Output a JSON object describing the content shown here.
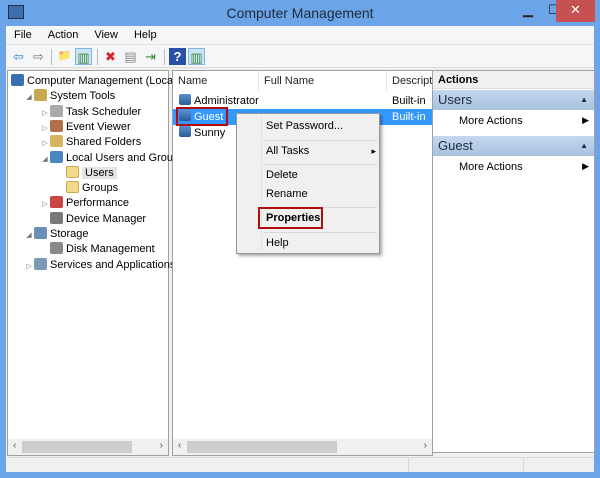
{
  "window": {
    "title": "Computer Management",
    "min": "▁",
    "max": "☐",
    "close": "✕"
  },
  "menu": [
    "File",
    "Action",
    "View",
    "Help"
  ],
  "toolbar": {
    "back": "⇦",
    "forward": "⇨",
    "up": "📁",
    "show_hide": "▥",
    "delete": "✖",
    "properties": "▤",
    "export": "⇥",
    "help": "?",
    "action_pane": "▥"
  },
  "tree": [
    {
      "label": "Computer Management (Local",
      "level": 0,
      "tw": ""
    },
    {
      "label": "System Tools",
      "level": 1,
      "tw": "◢"
    },
    {
      "label": "Task Scheduler",
      "level": 2,
      "tw": "▷"
    },
    {
      "label": "Event Viewer",
      "level": 2,
      "tw": "▷"
    },
    {
      "label": "Shared Folders",
      "level": 2,
      "tw": "▷"
    },
    {
      "label": "Local Users and Groups",
      "level": 2,
      "tw": "◢"
    },
    {
      "label": "Users",
      "level": 3,
      "tw": ""
    },
    {
      "label": "Groups",
      "level": 3,
      "tw": ""
    },
    {
      "label": "Performance",
      "level": 2,
      "tw": "▷"
    },
    {
      "label": "Device Manager",
      "level": 2,
      "tw": ""
    },
    {
      "label": "Storage",
      "level": 1,
      "tw": "◢"
    },
    {
      "label": "Disk Management",
      "level": 2,
      "tw": ""
    },
    {
      "label": "Services and Applications",
      "level": 1,
      "tw": "▷"
    }
  ],
  "list": {
    "columns": [
      "Name",
      "Full Name",
      "Descripti"
    ],
    "rows": [
      {
        "name": "Administrator",
        "full": "",
        "desc": "Built-in"
      },
      {
        "name": "Guest",
        "full": "",
        "desc": "Built-in"
      },
      {
        "name": "Sunny",
        "full": "",
        "desc": ""
      }
    ]
  },
  "context_menu": {
    "set_password": "Set Password...",
    "all_tasks": "All Tasks",
    "arrow": "▸",
    "delete": "Delete",
    "rename": "Rename",
    "properties": "Properties",
    "help": "Help"
  },
  "actions": {
    "title": "Actions",
    "sections": [
      {
        "name": "Users",
        "item": "More Actions"
      },
      {
        "name": "Guest",
        "item": "More Actions"
      }
    ],
    "collapse": "▲",
    "more": "▶"
  },
  "scroll": {
    "left": "‹",
    "right": "›"
  }
}
